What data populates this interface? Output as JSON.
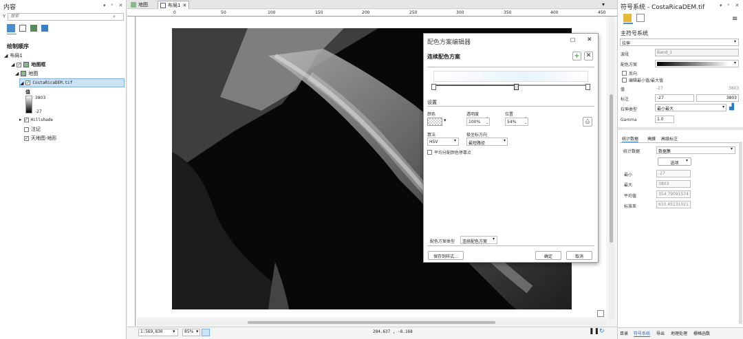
{
  "left": {
    "title": "内容",
    "search_placeholder": "搜索",
    "section": "绘制顺序",
    "tree": {
      "layout": "布局1",
      "mapframe": "地图框",
      "map": "地图",
      "layer": "CostaRicaDEM.tif",
      "value_heading": "值",
      "max": "3803",
      "min": "-27",
      "hillshade": "Hillshade",
      "annotation": "注记",
      "world": "天地图-地形"
    }
  },
  "tabs": {
    "map": "地图",
    "layout": "布局1"
  },
  "ruler": {
    "h": [
      "0",
      "50",
      "100",
      "150",
      "200",
      "250",
      "300",
      "350",
      "400",
      "450"
    ]
  },
  "status": {
    "scale": "1:569,830",
    "zoom": "85%",
    "coords": "284.637 , -8.168"
  },
  "dialog": {
    "title": "配色方案编辑器",
    "subtitle": "连续配色方案",
    "settings": "设置",
    "color_label": "颜色",
    "trans_label": "透明度",
    "trans_value": "100%",
    "pos_label": "位置",
    "pos_value": "54%",
    "algo_label": "算法",
    "algo_value": "HSV",
    "polar_label": "极坐标方向",
    "polar_value": "最短路径",
    "even_label": "平均分配颜色停靠点",
    "type_label": "配色方案类型",
    "type_value": "连续配色方案",
    "save_style": "保存到样式...",
    "ok": "确定",
    "cancel": "取消"
  },
  "right": {
    "title": "符号系统 - CostaRicaDEM.tif",
    "primary": "主符号系统",
    "renderer": "拉伸",
    "band_label": "波段",
    "band_value": "Band_1",
    "scheme_label": "配色方案",
    "invert": "反向",
    "edit_minmax": "编辑最小值/最大值",
    "value_label": "值",
    "value_min": "-27",
    "value_max": "3803",
    "label_label": "标注",
    "label_min": "-27",
    "label_max": "3803",
    "stretch_label": "拉伸类型",
    "stretch_value": "最小最大",
    "gamma_label": "Gamma",
    "gamma_value": "1.0",
    "subtabs": [
      "统计数据",
      "掩膜",
      "高级标注"
    ],
    "stats_label": "统计数据",
    "stats_value": "数据集",
    "options": "选项",
    "min_label": "最小",
    "min_value": "-27",
    "max_label": "最大",
    "max_value": "3803",
    "mean_label": "平均值",
    "mean_value": "354.79091574",
    "std_label": "标准差",
    "std_value": "610.45131021"
  },
  "bottom_tabs": [
    "目录",
    "符号系统",
    "导出",
    "地理处理",
    "栅格函数"
  ]
}
